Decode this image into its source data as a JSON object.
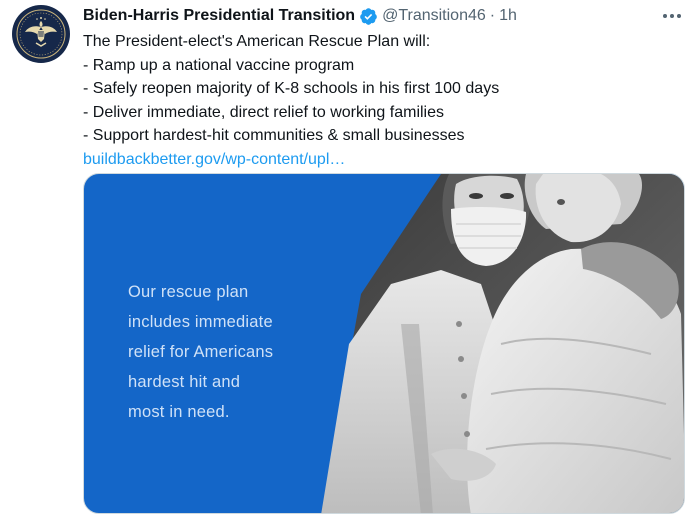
{
  "account": {
    "display_name": "Biden-Harris Presidential Transition",
    "handle": "@Transition46",
    "separator": "·",
    "time": "1h",
    "verified": true
  },
  "tweet": {
    "lines": [
      "The President-elect's American Rescue Plan will:",
      "- Ramp up a national vaccine program",
      "- Safely reopen majority of K-8 schools in his first 100 days",
      "- Deliver immediate, direct relief to working families",
      "- Support hardest-hit communities & small businesses"
    ],
    "link": "buildbackbetter.gov/wp-content/upl…"
  },
  "media": {
    "lines": [
      "Our rescue plan",
      "includes immediate",
      "relief for Americans",
      "hardest hit and",
      "most in need."
    ],
    "background_color": "#1466c8"
  },
  "colors": {
    "link": "#1d9bf0",
    "verified": "#1d9bf0",
    "secondary_text": "#536471"
  },
  "icons": {
    "avatar": "presidential-seal-icon",
    "verified": "verified-badge-icon",
    "more": "more-options-icon"
  }
}
